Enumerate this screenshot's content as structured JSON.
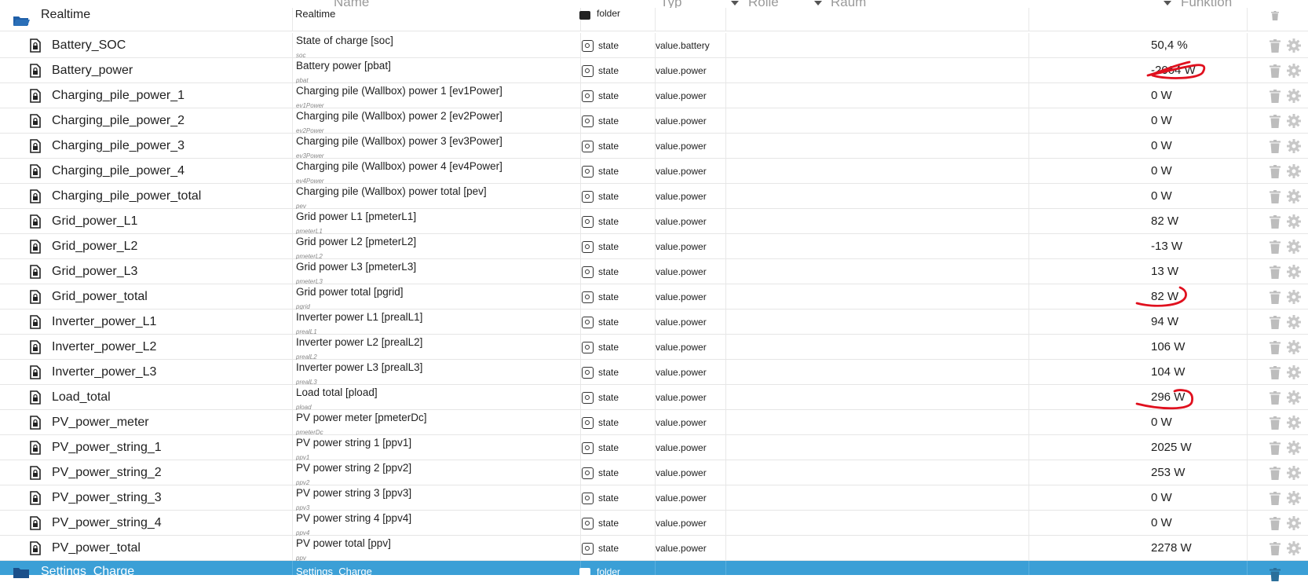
{
  "filters": {
    "name_placeholder": "Name",
    "type_placeholder": "Typ",
    "role_placeholder": "Rolle",
    "room_placeholder": "Raum",
    "function_placeholder": "Funktion"
  },
  "folder_top": {
    "name": "Realtime",
    "desc": "Realtime",
    "type": "folder"
  },
  "rows": [
    {
      "name": "Battery_SOC",
      "desc": "State of charge [soc]",
      "sub": "soc",
      "type": "state",
      "role": "value.battery",
      "value": "50,4 %"
    },
    {
      "name": "Battery_power",
      "desc": "Battery power [pbat]",
      "sub": "pbat",
      "type": "state",
      "role": "value.power",
      "value": "-2064 W"
    },
    {
      "name": "Charging_pile_power_1",
      "desc": "Charging pile (Wallbox) power 1 [ev1Power]",
      "sub": "ev1Power",
      "type": "state",
      "role": "value.power",
      "value": "0 W"
    },
    {
      "name": "Charging_pile_power_2",
      "desc": "Charging pile (Wallbox) power 2 [ev2Power]",
      "sub": "ev2Power",
      "type": "state",
      "role": "value.power",
      "value": "0 W"
    },
    {
      "name": "Charging_pile_power_3",
      "desc": "Charging pile (Wallbox) power 3 [ev3Power]",
      "sub": "ev3Power",
      "type": "state",
      "role": "value.power",
      "value": "0 W"
    },
    {
      "name": "Charging_pile_power_4",
      "desc": "Charging pile (Wallbox) power 4 [ev4Power]",
      "sub": "ev4Power",
      "type": "state",
      "role": "value.power",
      "value": "0 W"
    },
    {
      "name": "Charging_pile_power_total",
      "desc": "Charging pile (Wallbox) power total [pev]",
      "sub": "pev",
      "type": "state",
      "role": "value.power",
      "value": "0 W"
    },
    {
      "name": "Grid_power_L1",
      "desc": "Grid power L1 [pmeterL1]",
      "sub": "pmeterL1",
      "type": "state",
      "role": "value.power",
      "value": "82 W"
    },
    {
      "name": "Grid_power_L2",
      "desc": "Grid power L2 [pmeterL2]",
      "sub": "pmeterL2",
      "type": "state",
      "role": "value.power",
      "value": "-13 W"
    },
    {
      "name": "Grid_power_L3",
      "desc": "Grid power L3 [pmeterL3]",
      "sub": "pmeterL3",
      "type": "state",
      "role": "value.power",
      "value": "13 W"
    },
    {
      "name": "Grid_power_total",
      "desc": "Grid power total [pgrid]",
      "sub": "pgrid",
      "type": "state",
      "role": "value.power",
      "value": "82 W"
    },
    {
      "name": "Inverter_power_L1",
      "desc": "Inverter power L1 [prealL1]",
      "sub": "prealL1",
      "type": "state",
      "role": "value.power",
      "value": "94 W"
    },
    {
      "name": "Inverter_power_L2",
      "desc": "Inverter power L2 [prealL2]",
      "sub": "prealL2",
      "type": "state",
      "role": "value.power",
      "value": "106 W"
    },
    {
      "name": "Inverter_power_L3",
      "desc": "Inverter power L3 [prealL3]",
      "sub": "prealL3",
      "type": "state",
      "role": "value.power",
      "value": "104 W"
    },
    {
      "name": "Load_total",
      "desc": "Load total [pload]",
      "sub": "pload",
      "type": "state",
      "role": "value.power",
      "value": "296 W"
    },
    {
      "name": "PV_power_meter",
      "desc": "PV power meter [pmeterDc]",
      "sub": "pmeterDc",
      "type": "state",
      "role": "value.power",
      "value": "0 W"
    },
    {
      "name": "PV_power_string_1",
      "desc": "PV power string 1 [ppv1]",
      "sub": "ppv1",
      "type": "state",
      "role": "value.power",
      "value": "2025 W"
    },
    {
      "name": "PV_power_string_2",
      "desc": "PV power string 2 [ppv2]",
      "sub": "ppv2",
      "type": "state",
      "role": "value.power",
      "value": "253 W"
    },
    {
      "name": "PV_power_string_3",
      "desc": "PV power string 3 [ppv3]",
      "sub": "ppv3",
      "type": "state",
      "role": "value.power",
      "value": "0 W"
    },
    {
      "name": "PV_power_string_4",
      "desc": "PV power string 4 [ppv4]",
      "sub": "ppv4",
      "type": "state",
      "role": "value.power",
      "value": "0 W"
    },
    {
      "name": "PV_power_total",
      "desc": "PV power total [ppv]",
      "sub": "ppv",
      "type": "state",
      "role": "value.power",
      "value": "2278 W"
    }
  ],
  "folder_bottom": {
    "name": "Settings_Charge",
    "desc": "Settings_Charge",
    "type": "folder"
  },
  "colors": {
    "selected_row": "#3b9fd6",
    "annotation": "#e0101e"
  }
}
